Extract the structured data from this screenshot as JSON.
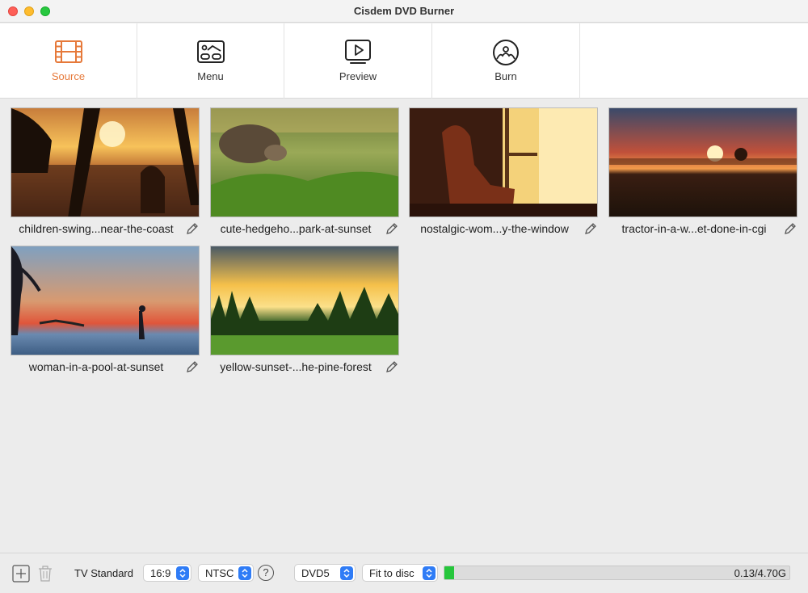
{
  "window": {
    "title": "Cisdem DVD Burner"
  },
  "toolbar": {
    "tabs": [
      {
        "label": "Source",
        "icon": "film-icon",
        "active": true
      },
      {
        "label": "Menu",
        "icon": "menu-icon"
      },
      {
        "label": "Preview",
        "icon": "play-icon"
      },
      {
        "label": "Burn",
        "icon": "disc-icon"
      }
    ],
    "accent_color": "#e6793a"
  },
  "videos": [
    {
      "name": "children-swing...near-the-coast"
    },
    {
      "name": "cute-hedgeho...park-at-sunset"
    },
    {
      "name": "nostalgic-wom...y-the-window"
    },
    {
      "name": "tractor-in-a-w...et-done-in-cgi"
    },
    {
      "name": "woman-in-a-pool-at-sunset"
    },
    {
      "name": "yellow-sunset-...he-pine-forest"
    }
  ],
  "bottom": {
    "tv_standard_label": "TV Standard",
    "aspect": "16:9",
    "standard": "NTSC",
    "help": "?",
    "disc_type": "DVD5",
    "fit": "Fit to disc",
    "capacity_text": "0.13/4.70G",
    "capacity_fraction": 0.028,
    "progress_color": "#26c63c"
  }
}
